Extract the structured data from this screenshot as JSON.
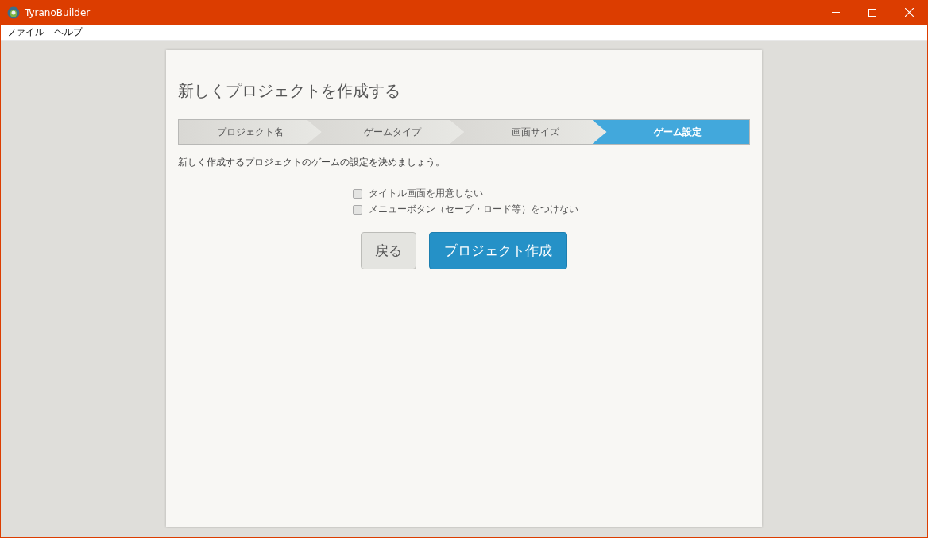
{
  "window": {
    "title": "TyranoBuilder"
  },
  "menu": [
    {
      "label": "ファイル"
    },
    {
      "label": "ヘルプ"
    }
  ],
  "dialog": {
    "title": "新しくプロジェクトを作成する",
    "steps": [
      {
        "label": "プロジェクト名",
        "selected": false
      },
      {
        "label": "ゲームタイプ",
        "selected": false
      },
      {
        "label": "画面サイズ",
        "selected": false
      },
      {
        "label": "ゲーム設定",
        "selected": true
      }
    ],
    "description": "新しく作成するプロジェクトのゲームの設定を決めましょう。",
    "options": [
      {
        "label": "タイトル画面を用意しない",
        "checked": false
      },
      {
        "label": "メニューボタン（セーブ・ロード等）をつけない",
        "checked": false
      }
    ],
    "buttons": [
      {
        "label": "戻る",
        "kind": "secondary"
      },
      {
        "label": "プロジェクト作成",
        "kind": "primary"
      }
    ]
  }
}
